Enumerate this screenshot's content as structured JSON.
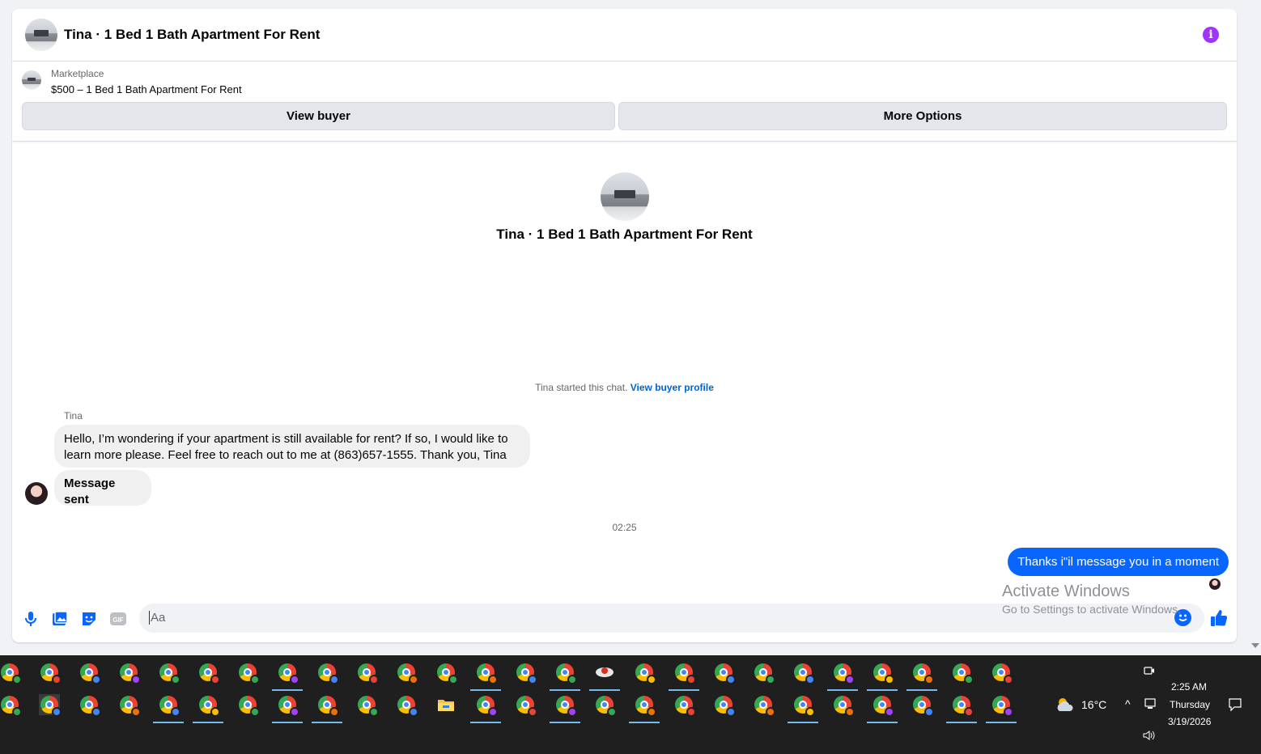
{
  "header": {
    "title": "Tina · 1 Bed 1 Bath Apartment For Rent",
    "info_icon": "info-icon",
    "accent": "#a033ff"
  },
  "marketplace": {
    "label": "Marketplace",
    "item": "$500 – 1 Bed 1 Bath Apartment For Rent",
    "view_buyer": "View buyer",
    "more_options": "More Options"
  },
  "intro": {
    "title": "Tina · 1 Bed 1 Bath Apartment For Rent",
    "started_text": "Tina started this chat.",
    "started_link": "View buyer profile"
  },
  "messages": {
    "sender": "Tina",
    "incoming_1": "Hello, I’m wondering if your apartment is still available for rent? If so, I would like to learn more please. Feel free to reach out to me at (863)657-1555.   Thank you, Tina",
    "incoming_2": "Message sent",
    "timestamp": "02:25",
    "outgoing_1": "Thanks i\"il message you in a moment",
    "outgoing_color": "#0866ff"
  },
  "composer": {
    "placeholder": "Aa",
    "icons": [
      "microphone-icon",
      "photo-icon",
      "sticker-icon",
      "gif-icon",
      "emoji-icon",
      "thumbs-up-icon"
    ],
    "gif_label": "GIF"
  },
  "watermark": {
    "line1": "Activate Windows",
    "line2": "Go to Settings to activate Windows."
  },
  "tray": {
    "weather": "16°C",
    "time": "2:25 AM",
    "day": "Thursday",
    "date": "3/19/2026"
  },
  "taskbar": {
    "row1_badges": [
      "#34a853",
      "#ea4335",
      "#4285f4",
      "#a142f4",
      "#34a853",
      "#ea4335",
      "#34a853",
      "#a142f4",
      "#4285f4",
      "#ea4335",
      "#e8710a",
      "#34a853",
      "#e8710a",
      "#4285f4",
      "#34a853",
      "special",
      "#fbbc05",
      "#ea4335",
      "#4285f4",
      "#34a853",
      "#4285f4",
      "#a142f4",
      "#fbbc05",
      "#e8710a",
      "#34a853",
      "#ea4335"
    ],
    "row2_badges": [
      "#34a853",
      "#4285f4",
      "#4285f4",
      "#e8710a",
      "#4285f4",
      "#fbbc05",
      "#34a853",
      "#a142f4",
      "#e8710a",
      "#34a853",
      "#4285f4",
      "folder",
      "#a142f4",
      "#ea4335",
      "#a142f4",
      "#34a853",
      "#e8710a",
      "#ea4335",
      "#4285f4",
      "#e8710a",
      "#fbbc05",
      "#e8710a",
      "#a142f4",
      "#4285f4",
      "#ea4335",
      "#a142f4"
    ]
  }
}
